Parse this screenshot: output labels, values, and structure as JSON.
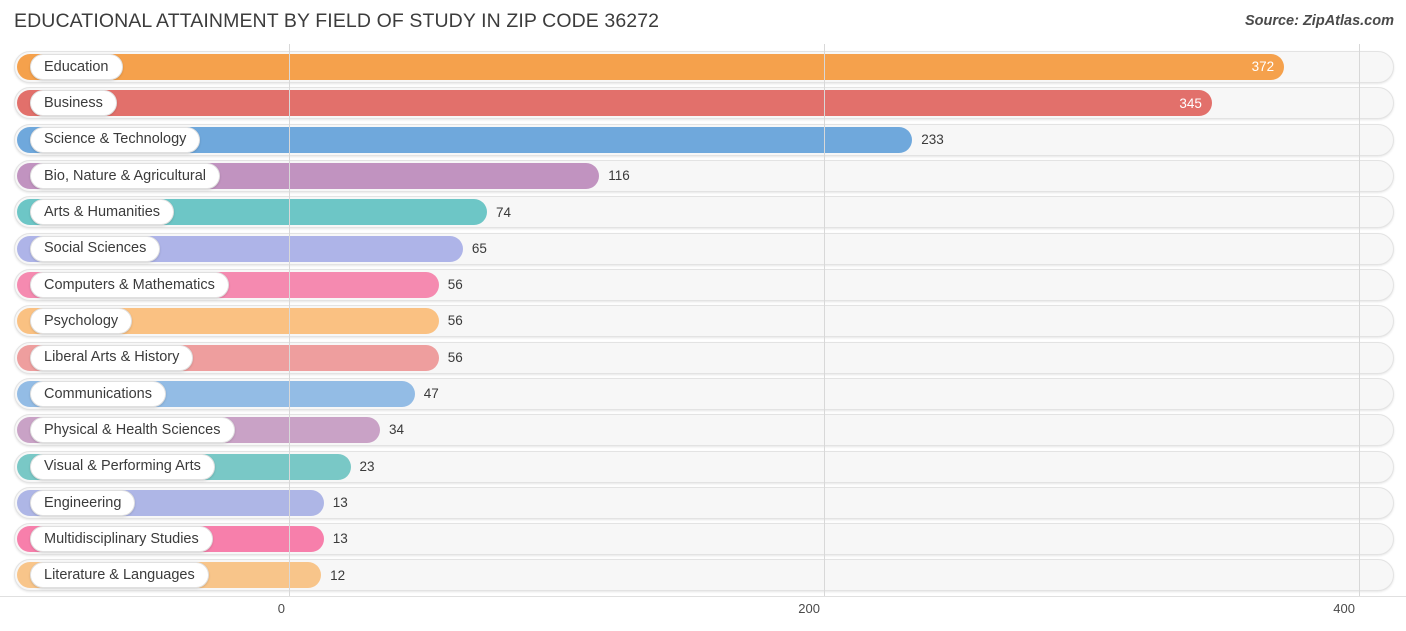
{
  "header": {
    "title": "EDUCATIONAL ATTAINMENT BY FIELD OF STUDY IN ZIP CODE 36272",
    "source": "Source: ZipAtlas.com"
  },
  "chart_data": {
    "type": "bar",
    "orientation": "horizontal",
    "title": "EDUCATIONAL ATTAINMENT BY FIELD OF STUDY IN ZIP CODE 36272",
    "xlabel": "",
    "ylabel": "",
    "xlim": [
      0,
      400
    ],
    "xticks": [
      0,
      200,
      400
    ],
    "xtick_labels": [
      "0",
      "200",
      "400"
    ],
    "grid": true,
    "legend": false,
    "categories": [
      "Education",
      "Business",
      "Science & Technology",
      "Bio, Nature & Agricultural",
      "Arts & Humanities",
      "Social Sciences",
      "Computers & Mathematics",
      "Psychology",
      "Liberal Arts & History",
      "Communications",
      "Physical & Health Sciences",
      "Visual & Performing Arts",
      "Engineering",
      "Multidisciplinary Studies",
      "Literature & Languages"
    ],
    "values": [
      372,
      345,
      233,
      116,
      74,
      65,
      56,
      56,
      56,
      47,
      34,
      23,
      13,
      13,
      12
    ],
    "value_labels": [
      "372",
      "345",
      "233",
      "116",
      "74",
      "65",
      "56",
      "56",
      "56",
      "47",
      "34",
      "23",
      "13",
      "13",
      "12"
    ],
    "colors": [
      "#F5A14C",
      "#E2706B",
      "#6FA8DC",
      "#C193C0",
      "#6DC6C6",
      "#AEB4E8",
      "#F58AB0",
      "#FAC182",
      "#EE9E9E",
      "#93BCE5",
      "#C9A2C6",
      "#79C8C6",
      "#AEB6E6",
      "#F77FAB",
      "#F8C58A"
    ]
  }
}
